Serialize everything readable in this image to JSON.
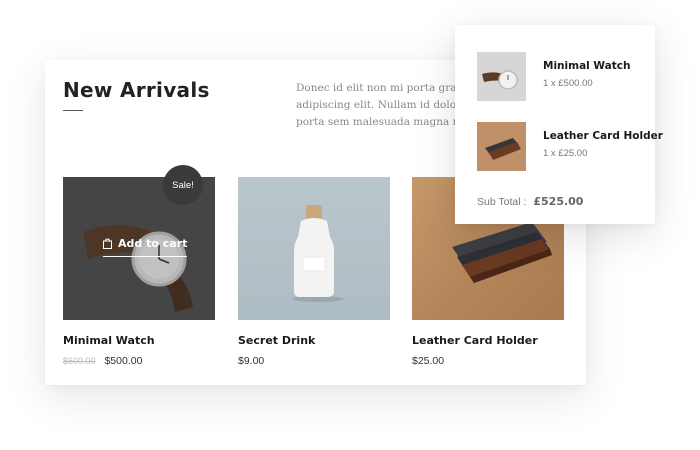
{
  "section": {
    "title": "New Arrivals",
    "intro": "Donec id elit non mi porta gravida at\nadipiscing elit. Nullam id dolor id n\nporta sem malesuada magna mollis"
  },
  "products": [
    {
      "name": "Minimal Watch",
      "old_price": "$600.00",
      "price": "$500.00",
      "badge": "Sale!",
      "action": "Add to cart",
      "image_icon": "watch-icon"
    },
    {
      "name": "Secret Drink",
      "price": "$9.00",
      "image_icon": "bottle-icon"
    },
    {
      "name": "Leather Card Holder",
      "price": "$25.00",
      "image_icon": "card-holder-icon"
    }
  ],
  "cart": {
    "items": [
      {
        "name": "Minimal Watch",
        "qty": "1 x £500.00",
        "image_icon": "watch-icon"
      },
      {
        "name": "Leather Card Holder",
        "qty": "1 x £25.00",
        "image_icon": "card-holder-icon"
      }
    ],
    "subtotal_label": "Sub Total :",
    "subtotal_value": "£525.00"
  },
  "colors": {
    "badge_bg": "#3a3a3a",
    "watch_bg": "#4f4f4f",
    "drink_bg": "#b9c7cd",
    "holder_bg": "#c69a6a",
    "muted_text": "#888888"
  }
}
